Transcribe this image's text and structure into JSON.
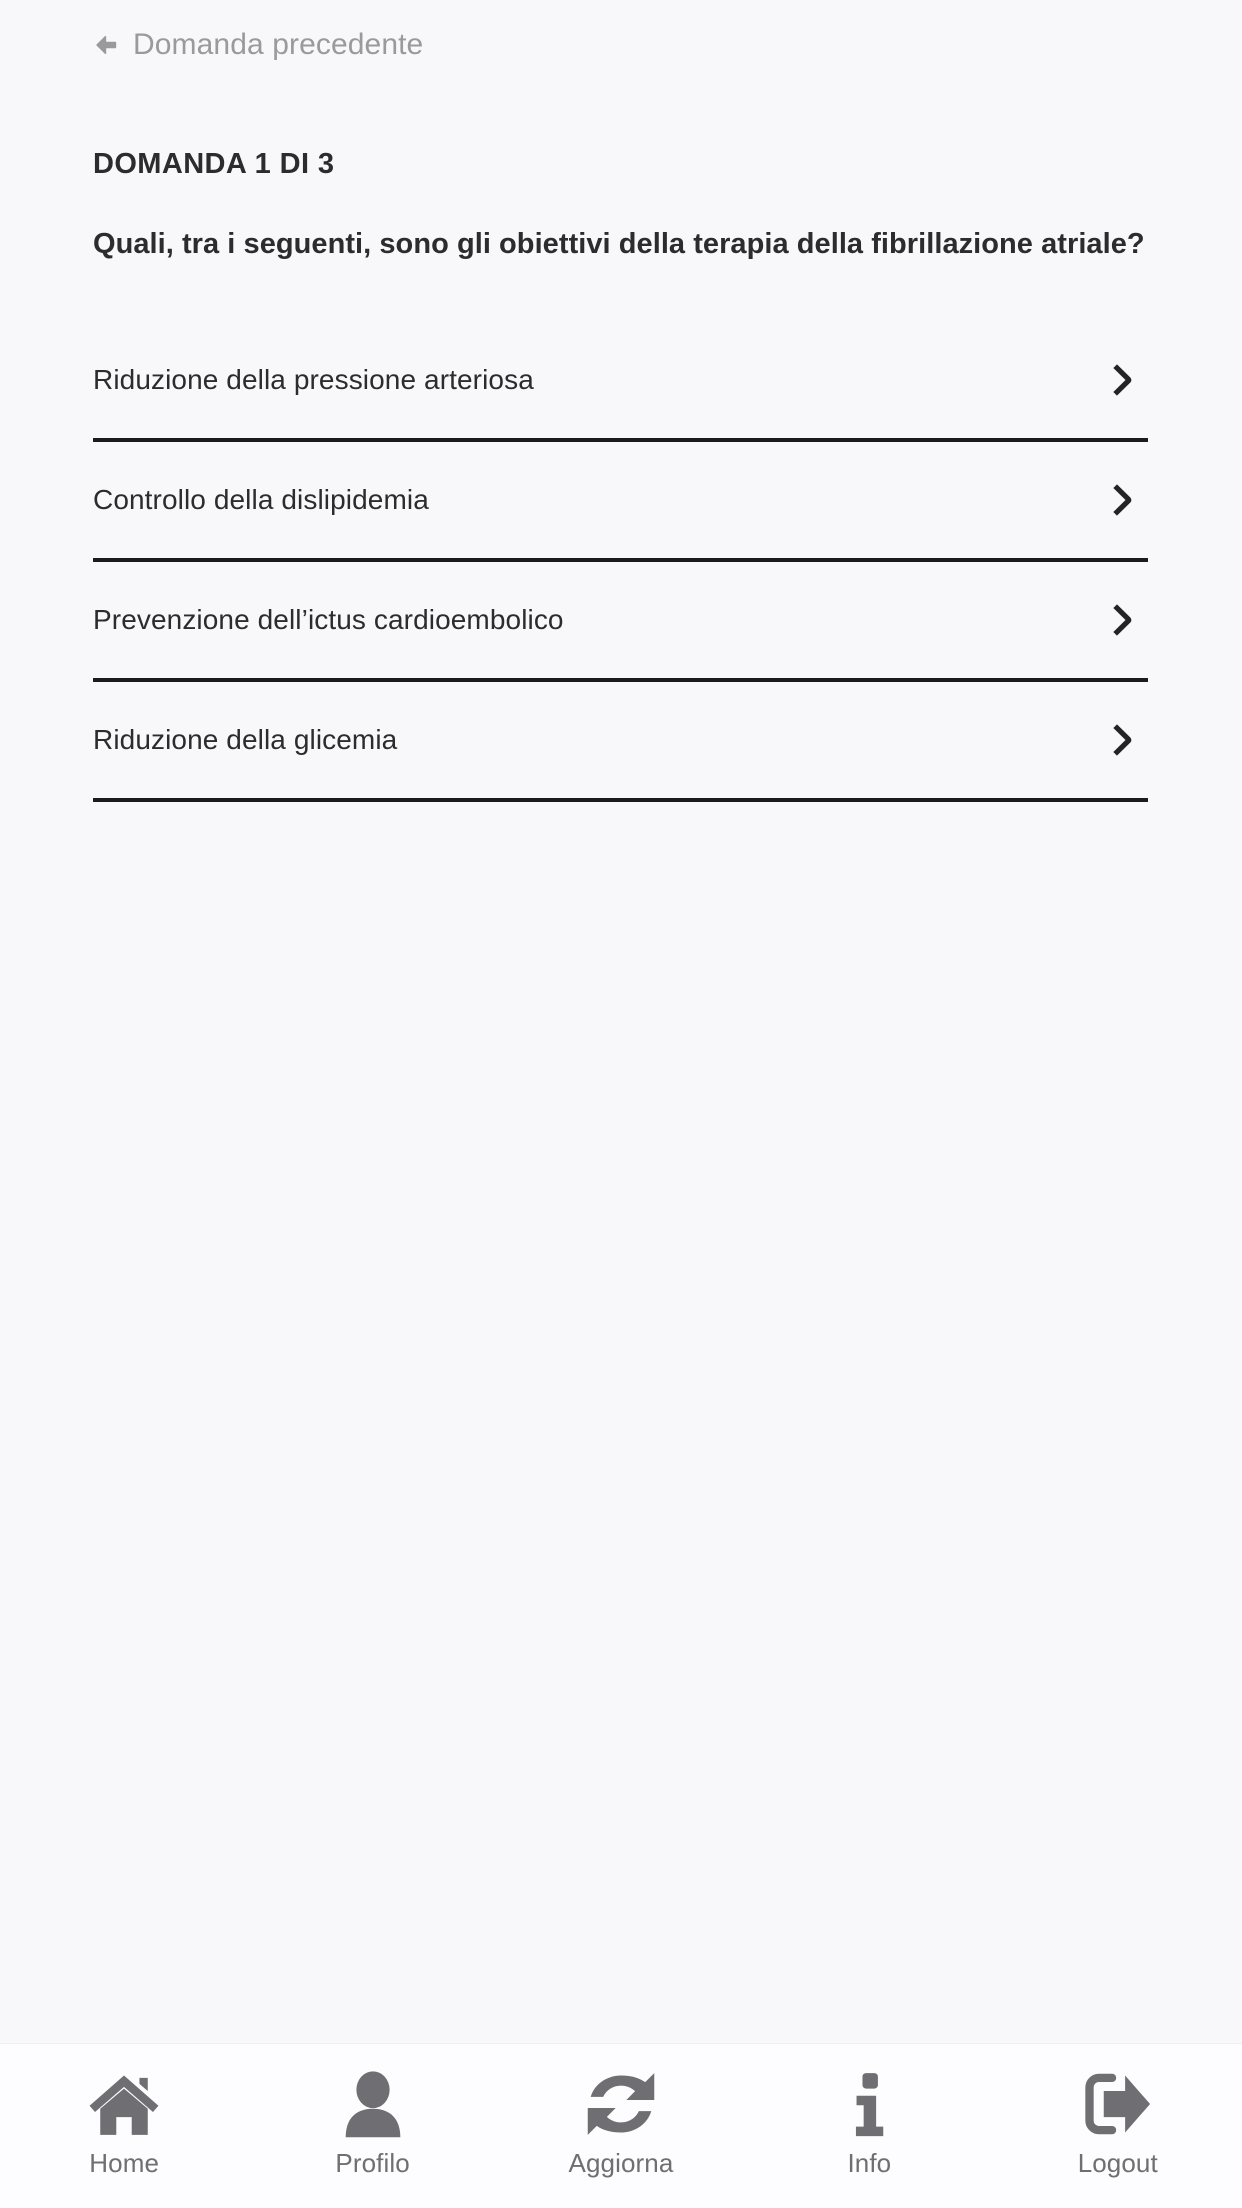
{
  "colors": {
    "page_background": "#f8f8fa",
    "tabbar_background": "#fdfdff",
    "text_primary": "#2c2c2e",
    "text_muted": "#9a9a9e",
    "tab_icon": "#6e6e73",
    "divider": "#1b1b1d"
  },
  "back": {
    "label": "Domanda precedente",
    "icon": "arrow-left-icon"
  },
  "question": {
    "counter": "DOMANDA 1 DI 3",
    "text": "Quali, tra i seguenti, sono gli obiettivi della terapia della fibrillazione atriale?",
    "index": 1,
    "total": 3
  },
  "answers": [
    {
      "label": "Riduzione della pressione arteriosa",
      "chevron": "chevron-right-icon"
    },
    {
      "label": "Controllo della dislipidemia",
      "chevron": "chevron-right-icon"
    },
    {
      "label": "Prevenzione dell’ictus cardioembolico",
      "chevron": "chevron-right-icon"
    },
    {
      "label": "Riduzione della glicemia",
      "chevron": "chevron-right-icon"
    }
  ],
  "tabbar": {
    "items": [
      {
        "label": "Home",
        "icon": "home-icon"
      },
      {
        "label": "Profilo",
        "icon": "user-icon"
      },
      {
        "label": "Aggiorna",
        "icon": "refresh-icon"
      },
      {
        "label": "Info",
        "icon": "info-icon"
      },
      {
        "label": "Logout",
        "icon": "logout-icon"
      }
    ]
  }
}
